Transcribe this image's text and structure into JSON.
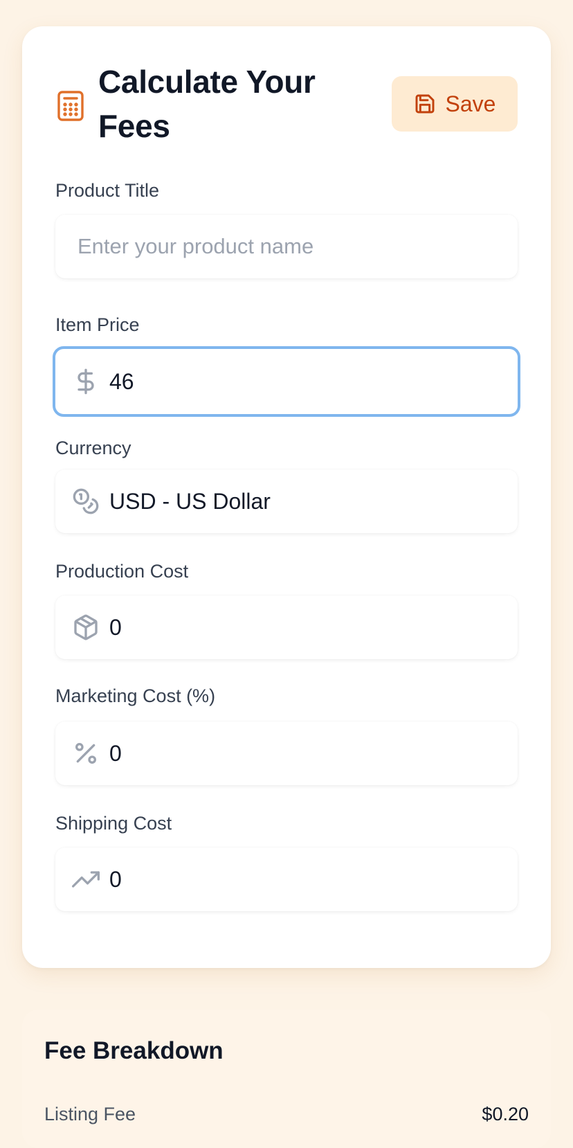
{
  "header": {
    "title": "Calculate Your Fees",
    "save_label": "Save"
  },
  "fields": {
    "product_title": {
      "label": "Product Title",
      "placeholder": "Enter your product name",
      "value": ""
    },
    "item_price": {
      "label": "Item Price",
      "value": "46",
      "icon": "dollar-icon"
    },
    "currency": {
      "label": "Currency",
      "value": "USD - US Dollar",
      "icon": "coins-icon"
    },
    "production_cost": {
      "label": "Production Cost",
      "value": "0",
      "icon": "package-icon"
    },
    "marketing_cost": {
      "label": "Marketing Cost (%)",
      "value": "0",
      "icon": "percent-icon"
    },
    "shipping_cost": {
      "label": "Shipping Cost",
      "value": "0",
      "icon": "trending-up-icon"
    }
  },
  "breakdown": {
    "title": "Fee Breakdown",
    "rows": [
      {
        "label": "Listing Fee",
        "value": "$0.20"
      }
    ]
  },
  "colors": {
    "background": "#fdf3e6",
    "accent": "#c2410c",
    "save_bg": "#feebd2",
    "focus_ring": "#7fb6ee"
  }
}
